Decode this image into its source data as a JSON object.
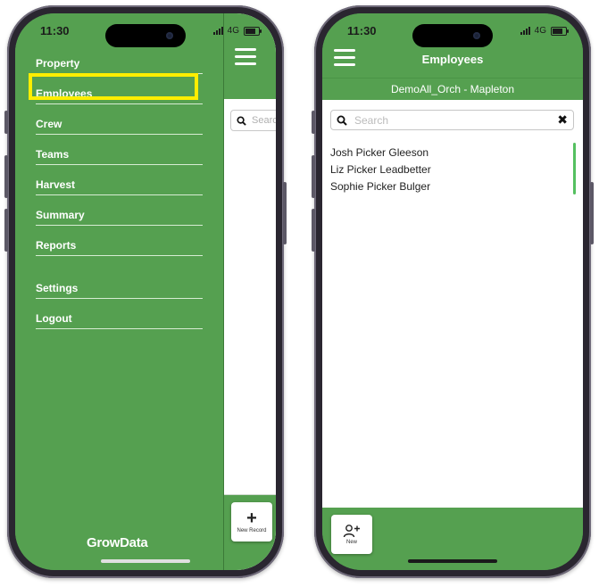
{
  "status_bar": {
    "time": "11:30",
    "network": "4G"
  },
  "left_phone": {
    "nav_items": [
      {
        "label": "Property"
      },
      {
        "label": "Employees"
      },
      {
        "label": "Crew"
      },
      {
        "label": "Teams"
      },
      {
        "label": "Harvest"
      },
      {
        "label": "Summary"
      },
      {
        "label": "Reports"
      },
      {
        "label": "Settings"
      },
      {
        "label": "Logout"
      }
    ],
    "highlighted_item": "Employees",
    "highlight_color": "#ffee00",
    "search_placeholder": "Search",
    "new_record_label": "New Record",
    "logo_text": "GrowData"
  },
  "right_phone": {
    "title": "Employees",
    "subtitle": "DemoAll_Orch - Mapleton",
    "search_placeholder": "Search",
    "employees": [
      {
        "name": "Josh Picker Gleeson"
      },
      {
        "name": "Liz Picker Leadbetter"
      },
      {
        "name": "Sophie Picker Bulger"
      }
    ],
    "new_label": "New"
  },
  "colors": {
    "brand_green": "#55a050",
    "scroll_indicator": "#55c060"
  }
}
